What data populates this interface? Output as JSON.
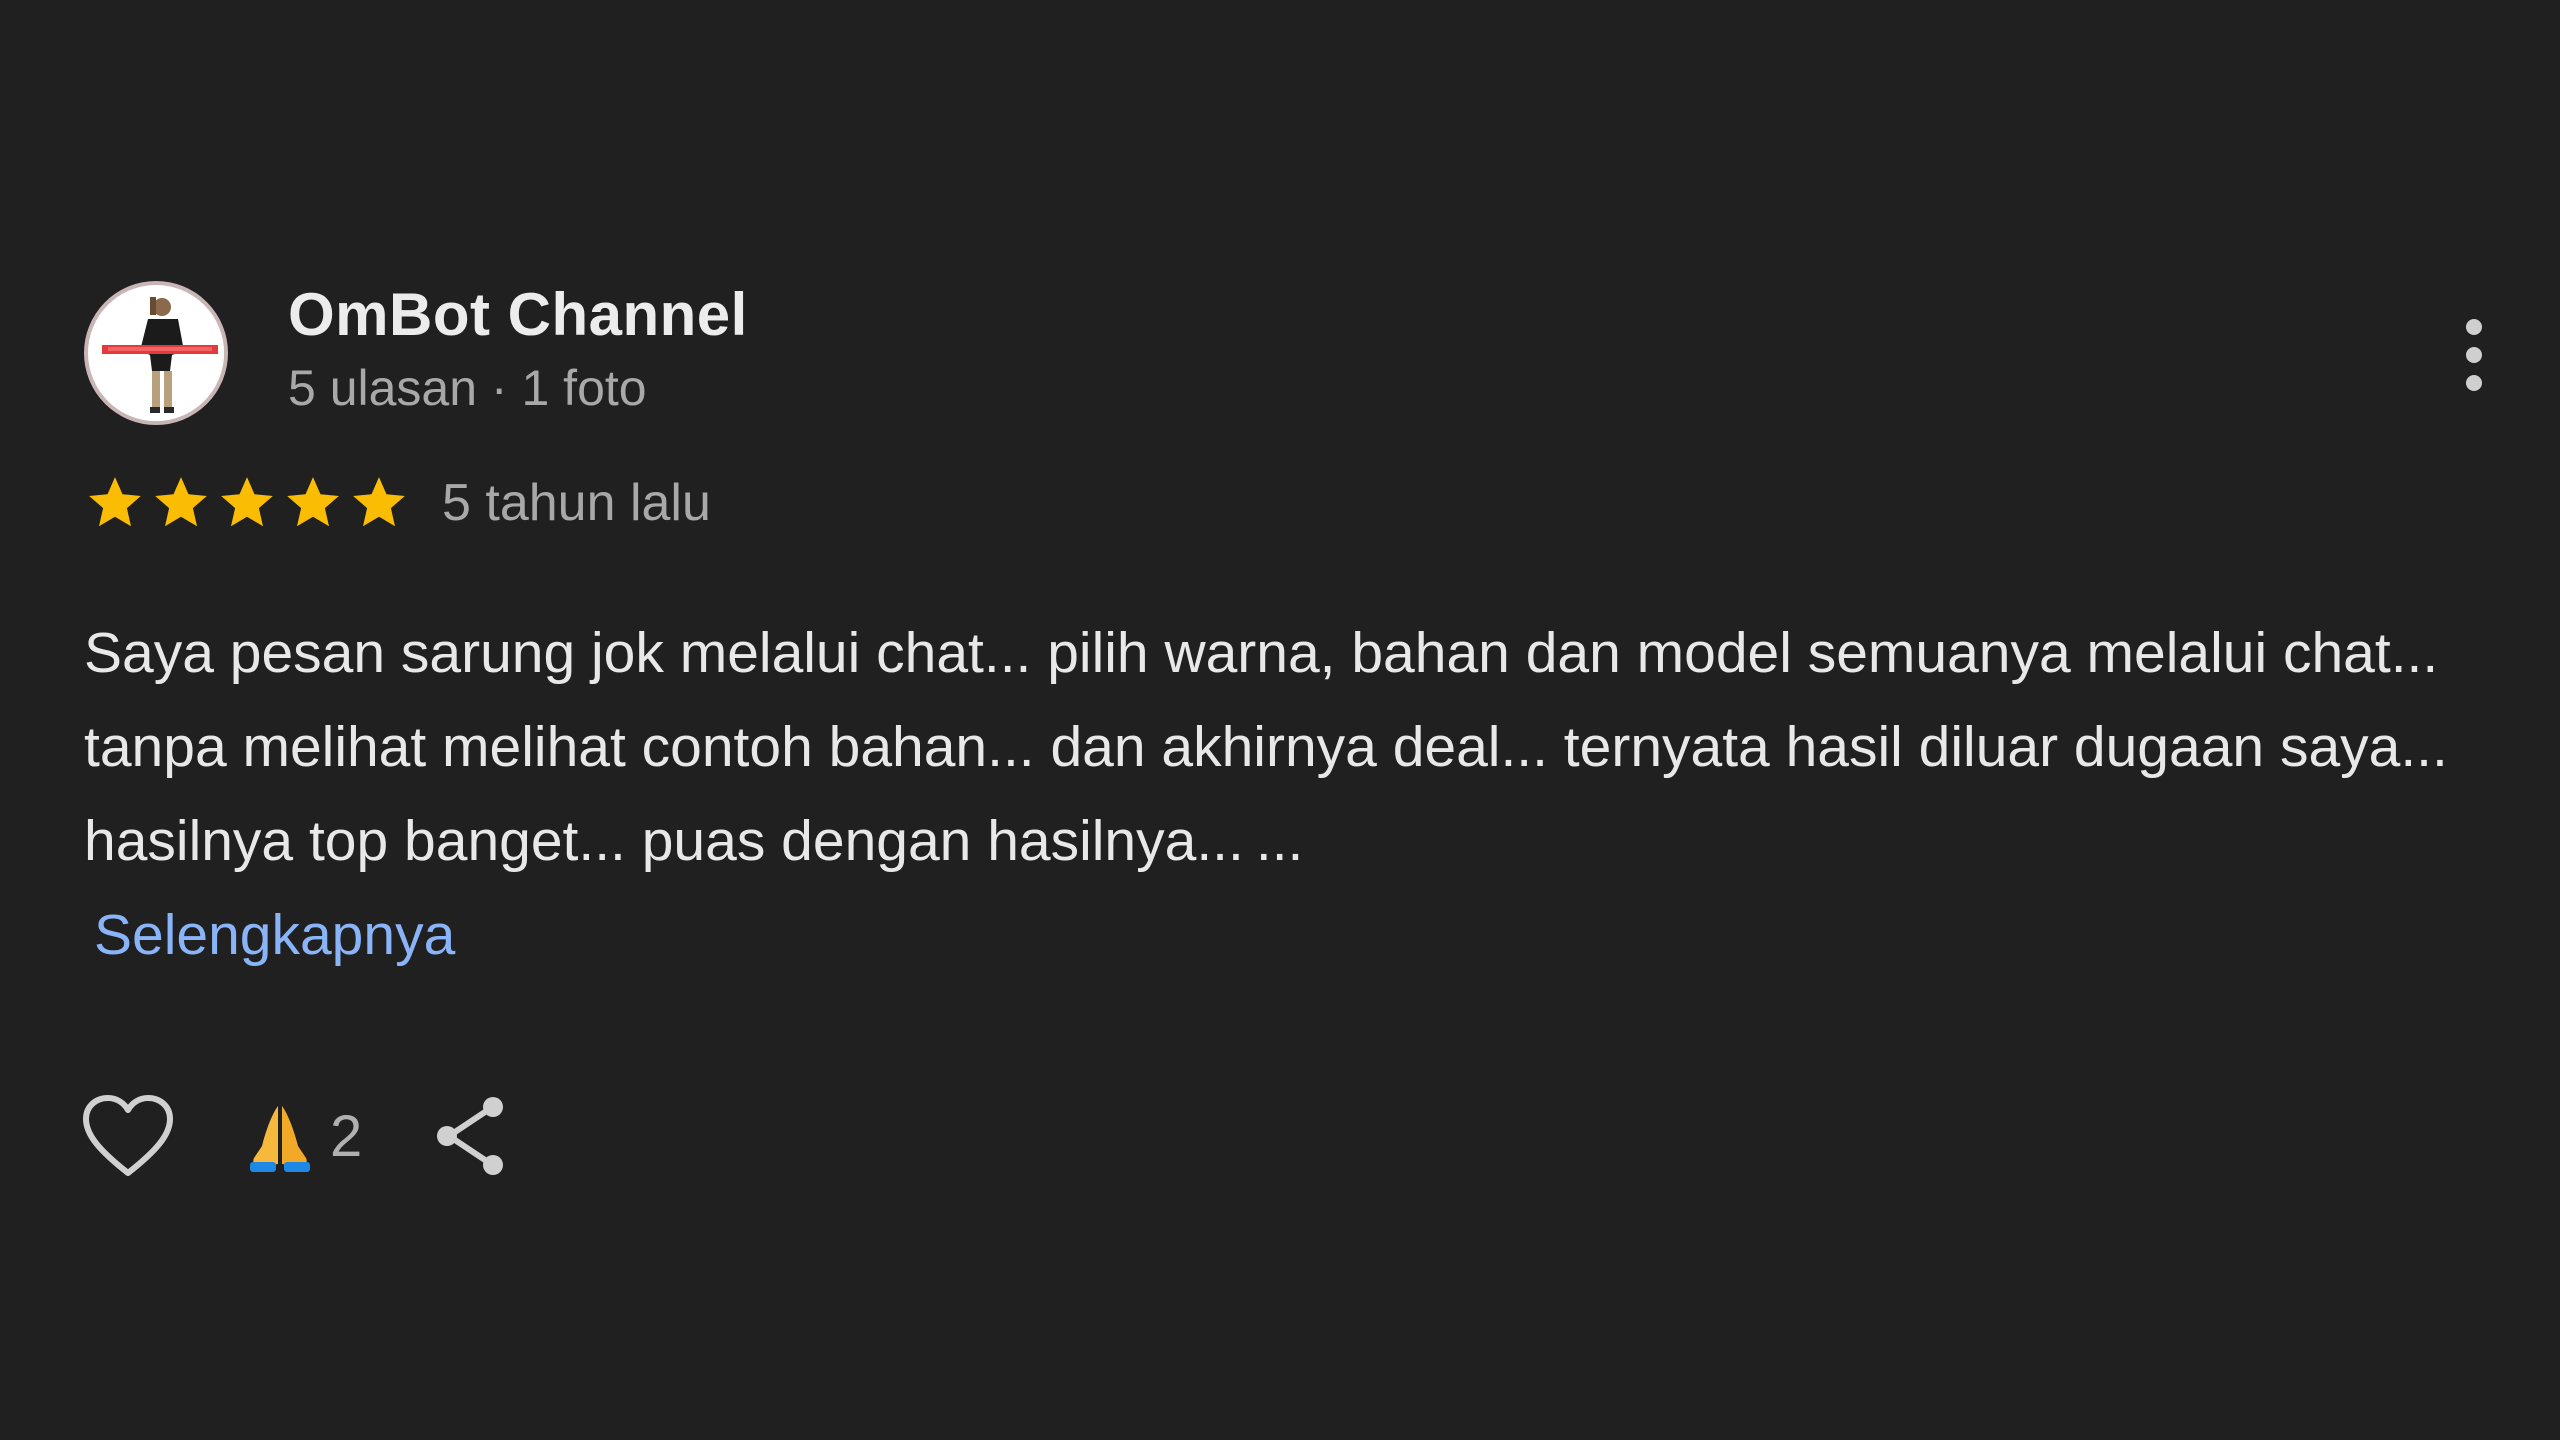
{
  "review": {
    "author": {
      "name": "OmBot Channel",
      "meta": "5 ulasan · 1 foto",
      "avatar_icon": "avatar-image"
    },
    "rating": {
      "stars": 5,
      "max_stars": 5,
      "time": "5 tahun lalu",
      "star_color": "#fbbc04"
    },
    "text": "Saya pesan sarung jok melalui chat... pilih warna, bahan dan model semuanya melalui chat... tanpa melihat melihat contoh bahan... dan akhirnya deal... ternyata hasil diluar dugaan saya... hasilnya top banget... puas dengan hasilnya...",
    "ellipsis": "...",
    "more_label": "Selengkapnya",
    "actions": {
      "like_icon": "heart-outline-icon",
      "reaction_icon": "folded-hands-emoji",
      "reaction_count": "2",
      "share_icon": "share-icon",
      "menu_icon": "more-vertical-icon"
    }
  },
  "colors": {
    "background": "#202020",
    "text": "#e8e8e8",
    "secondary_text": "#a8a8a8",
    "link": "#8ab4f8"
  }
}
